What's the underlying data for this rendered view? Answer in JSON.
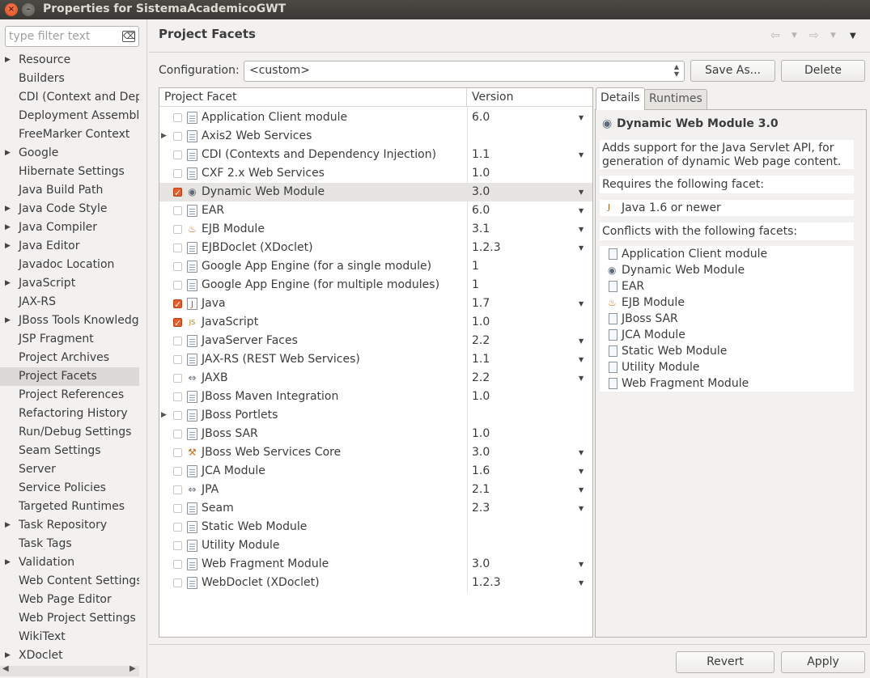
{
  "window": {
    "title": "Properties for SistemaAcademicoGWT",
    "close_symbol": "×",
    "minimize_symbol": "–"
  },
  "filter": {
    "placeholder": "type filter text",
    "clear_symbol": "⌫"
  },
  "nav": {
    "items": [
      {
        "label": "Resource",
        "expandable": true
      },
      {
        "label": "Builders",
        "expandable": false
      },
      {
        "label": "CDI (Context and Depe",
        "expandable": false
      },
      {
        "label": "Deployment Assembly",
        "expandable": false
      },
      {
        "label": "FreeMarker Context",
        "expandable": false
      },
      {
        "label": "Google",
        "expandable": true
      },
      {
        "label": "Hibernate Settings",
        "expandable": false
      },
      {
        "label": "Java Build Path",
        "expandable": false
      },
      {
        "label": "Java Code Style",
        "expandable": true
      },
      {
        "label": "Java Compiler",
        "expandable": true
      },
      {
        "label": "Java Editor",
        "expandable": true
      },
      {
        "label": "Javadoc Location",
        "expandable": false
      },
      {
        "label": "JavaScript",
        "expandable": true
      },
      {
        "label": "JAX-RS",
        "expandable": false
      },
      {
        "label": "JBoss Tools Knowledge",
        "expandable": true
      },
      {
        "label": "JSP Fragment",
        "expandable": false
      },
      {
        "label": "Project Archives",
        "expandable": false
      },
      {
        "label": "Project Facets",
        "expandable": false,
        "selected": true
      },
      {
        "label": "Project References",
        "expandable": false
      },
      {
        "label": "Refactoring History",
        "expandable": false
      },
      {
        "label": "Run/Debug Settings",
        "expandable": false
      },
      {
        "label": "Seam Settings",
        "expandable": false
      },
      {
        "label": "Server",
        "expandable": false
      },
      {
        "label": "Service Policies",
        "expandable": false
      },
      {
        "label": "Targeted Runtimes",
        "expandable": false
      },
      {
        "label": "Task Repository",
        "expandable": true
      },
      {
        "label": "Task Tags",
        "expandable": false
      },
      {
        "label": "Validation",
        "expandable": true
      },
      {
        "label": "Web Content Settings",
        "expandable": false
      },
      {
        "label": "Web Page Editor",
        "expandable": false
      },
      {
        "label": "Web Project Settings",
        "expandable": false
      },
      {
        "label": "WikiText",
        "expandable": false
      },
      {
        "label": "XDoclet",
        "expandable": true
      }
    ]
  },
  "page": {
    "title": "Project Facets"
  },
  "config": {
    "label": "Configuration:",
    "value": "<custom>",
    "save_as": "Save As...",
    "delete": "Delete"
  },
  "table": {
    "col_facet": "Project Facet",
    "col_version": "Version",
    "rows": [
      {
        "name": "Application Client module",
        "version": "6.0",
        "checked": false,
        "dropdown": true,
        "icon": "page",
        "expandable": false
      },
      {
        "name": "Axis2 Web Services",
        "version": "",
        "checked": false,
        "dropdown": false,
        "icon": "page",
        "expandable": true
      },
      {
        "name": "CDI (Contexts and Dependency Injection)",
        "version": "1.1",
        "checked": false,
        "dropdown": true,
        "icon": "page",
        "expandable": false
      },
      {
        "name": "CXF 2.x Web Services",
        "version": "1.0",
        "checked": false,
        "dropdown": false,
        "icon": "page",
        "expandable": false
      },
      {
        "name": "Dynamic Web Module",
        "version": "3.0",
        "checked": true,
        "dropdown": true,
        "icon": "globe",
        "expandable": false,
        "selected": true
      },
      {
        "name": "EAR",
        "version": "6.0",
        "checked": false,
        "dropdown": true,
        "icon": "page",
        "expandable": false
      },
      {
        "name": "EJB Module",
        "version": "3.1",
        "checked": false,
        "dropdown": true,
        "icon": "bean",
        "expandable": false
      },
      {
        "name": "EJBDoclet (XDoclet)",
        "version": "1.2.3",
        "checked": false,
        "dropdown": true,
        "icon": "page",
        "expandable": false
      },
      {
        "name": "Google App Engine (for a single module)",
        "version": "1",
        "checked": false,
        "dropdown": false,
        "icon": "page",
        "expandable": false
      },
      {
        "name": "Google App Engine (for multiple modules)",
        "version": "1",
        "checked": false,
        "dropdown": false,
        "icon": "page",
        "expandable": false
      },
      {
        "name": "Java",
        "version": "1.7",
        "checked": true,
        "dropdown": true,
        "icon": "java",
        "expandable": false
      },
      {
        "name": "JavaScript",
        "version": "1.0",
        "checked": true,
        "dropdown": false,
        "icon": "js",
        "expandable": false
      },
      {
        "name": "JavaServer Faces",
        "version": "2.2",
        "checked": false,
        "dropdown": true,
        "icon": "page",
        "expandable": false
      },
      {
        "name": "JAX-RS (REST Web Services)",
        "version": "1.1",
        "checked": false,
        "dropdown": true,
        "icon": "page",
        "expandable": false
      },
      {
        "name": "JAXB",
        "version": "2.2",
        "checked": false,
        "dropdown": true,
        "icon": "arrows",
        "expandable": false
      },
      {
        "name": "JBoss Maven Integration",
        "version": "1.0",
        "checked": false,
        "dropdown": false,
        "icon": "page",
        "expandable": false
      },
      {
        "name": "JBoss Portlets",
        "version": "",
        "checked": false,
        "dropdown": false,
        "icon": "page",
        "expandable": true
      },
      {
        "name": "JBoss SAR",
        "version": "1.0",
        "checked": false,
        "dropdown": false,
        "icon": "page",
        "expandable": false
      },
      {
        "name": "JBoss Web Services Core",
        "version": "3.0",
        "checked": false,
        "dropdown": true,
        "icon": "tools",
        "expandable": false
      },
      {
        "name": "JCA Module",
        "version": "1.6",
        "checked": false,
        "dropdown": true,
        "icon": "page",
        "expandable": false
      },
      {
        "name": "JPA",
        "version": "2.1",
        "checked": false,
        "dropdown": true,
        "icon": "arrows",
        "expandable": false
      },
      {
        "name": "Seam",
        "version": "2.3",
        "checked": false,
        "dropdown": true,
        "icon": "page",
        "expandable": false
      },
      {
        "name": "Static Web Module",
        "version": "",
        "checked": false,
        "dropdown": false,
        "icon": "page",
        "expandable": false
      },
      {
        "name": "Utility Module",
        "version": "",
        "checked": false,
        "dropdown": false,
        "icon": "page",
        "expandable": false
      },
      {
        "name": "Web Fragment Module",
        "version": "3.0",
        "checked": false,
        "dropdown": true,
        "icon": "page",
        "expandable": false
      },
      {
        "name": "WebDoclet (XDoclet)",
        "version": "1.2.3",
        "checked": false,
        "dropdown": true,
        "icon": "page",
        "expandable": false
      }
    ]
  },
  "details": {
    "tab_details": "Details",
    "tab_runtimes": "Runtimes",
    "title": "Dynamic Web Module 3.0",
    "description": "Adds support for the Java Servlet API, for generation of dynamic Web page content.",
    "requires_label": "Requires the following facet:",
    "requires": [
      {
        "label": "Java 1.6 or newer",
        "icon": "java"
      }
    ],
    "conflicts_label": "Conflicts with the following facets:",
    "conflicts": [
      {
        "label": "Application Client module",
        "icon": "page"
      },
      {
        "label": "Dynamic Web Module",
        "icon": "globe"
      },
      {
        "label": "EAR",
        "icon": "page"
      },
      {
        "label": "EJB Module",
        "icon": "bean"
      },
      {
        "label": "JBoss SAR",
        "icon": "page"
      },
      {
        "label": "JCA Module",
        "icon": "page"
      },
      {
        "label": "Static Web Module",
        "icon": "page"
      },
      {
        "label": "Utility Module",
        "icon": "page"
      },
      {
        "label": "Web Fragment Module",
        "icon": "page"
      }
    ]
  },
  "buttons": {
    "revert": "Revert",
    "apply": "Apply"
  },
  "colors": {
    "accent_check": "#e85a2a",
    "titlebar": "#3c3b37"
  }
}
